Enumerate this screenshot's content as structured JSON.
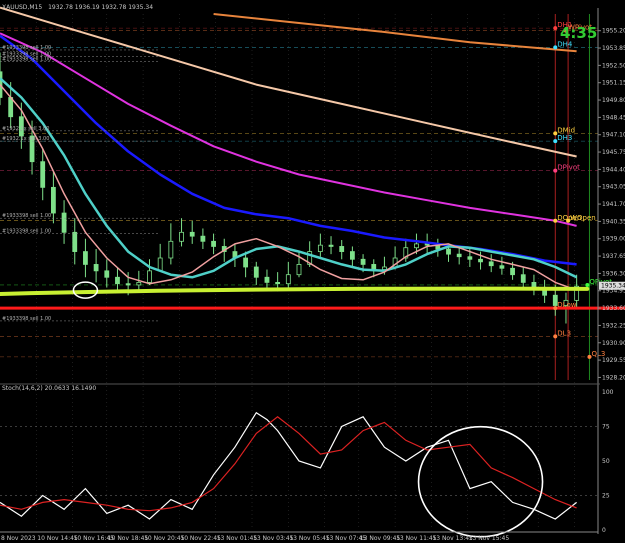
{
  "window": {
    "title": "XAUUSD,M15",
    "ohlc": "1932.78 1936.19 1932.78 1935.34",
    "timer": "4:35",
    "stoch_title": "Stoch(14,6,2) 20.0633 16.1490"
  },
  "colors": {
    "background": "#000000",
    "candle": "#7fe08a",
    "ma_blue": "#1a1aff",
    "ma_teal": "#4fd0c8",
    "ma_pink": "#f0a0a0",
    "ma_magenta": "#e033e0",
    "ma_peach": "#f5c8a8",
    "ma_orange": "#e8843c",
    "support": "#c8f032",
    "red_line": "#ff1a1a",
    "stoch_main": "#ffffff",
    "stoch_signal": "#dd2222",
    "timer": "#33cc33",
    "grid": "#3a3a3a"
  },
  "chart_data": [
    {
      "type": "line",
      "panel": "price",
      "ylim": [
        1928.0,
        1956.5
      ],
      "y_ticks": [
        1955.2,
        1953.85,
        1952.5,
        1951.15,
        1949.8,
        1948.45,
        1947.1,
        1945.75,
        1944.4,
        1943.05,
        1941.7,
        1940.35,
        1939.0,
        1937.65,
        1936.3,
        1934.95,
        1933.6,
        1932.25,
        1930.9,
        1929.55,
        1928.2
      ],
      "y_tick_labels": [
        "1955.20",
        "1953.85",
        "1952.50",
        "1951.15",
        "1949.80",
        "1948.45",
        "1947.10",
        "1945.75",
        "1944.40",
        "1943.05",
        "1941.70",
        "1940.35",
        "1939.00",
        "1937.65",
        "1936.30",
        "1934.95",
        "1933.60",
        "1932.25",
        "1930.90",
        "1929.55",
        "1928.20"
      ],
      "x_ticks": [
        0,
        17,
        34,
        50,
        67,
        84,
        101,
        118,
        135,
        152,
        168,
        185,
        202,
        219,
        236,
        252,
        269
      ],
      "x_tick_labels": [
        "8 Nov 2023",
        "10 Nov 14:45",
        "10 Nov 16:45",
        "10 Nov 18:45",
        "10 Nov 20:45",
        "10 Nov 22:45",
        "13 Nov 01:45",
        "13 Nov 03:45",
        "13 Nov 05:45",
        "13 Nov 07:45",
        "13 Nov 09:45",
        "13 Nov 11:45",
        "13 Nov 13:45",
        "13 Nov 15:45",
        "",
        "",
        ""
      ],
      "current_price": 1935.34,
      "current_price_label": "1935.34",
      "series": [
        {
          "key": "ma_orange",
          "x": [
            100,
            140,
            180,
            220,
            270
          ],
          "y": [
            1956.5,
            1955.8,
            1955.1,
            1954.3,
            1953.6
          ]
        },
        {
          "key": "ma_peach",
          "x": [
            0,
            40,
            80,
            120,
            160,
            200,
            240,
            270
          ],
          "y": [
            1957.0,
            1955.0,
            1953.0,
            1951.0,
            1949.5,
            1948.0,
            1946.5,
            1945.4
          ]
        },
        {
          "key": "ma_magenta",
          "x": [
            0,
            20,
            40,
            60,
            80,
            100,
            120,
            140,
            160,
            180,
            200,
            220,
            240,
            260,
            270
          ],
          "y": [
            1955.0,
            1953.5,
            1951.5,
            1949.5,
            1947.8,
            1946.2,
            1945.0,
            1944.0,
            1943.3,
            1942.6,
            1942.0,
            1941.4,
            1940.9,
            1940.4,
            1940.0
          ]
        },
        {
          "key": "ma_blue",
          "x": [
            0,
            15,
            30,
            45,
            60,
            75,
            90,
            105,
            120,
            135,
            150,
            165,
            180,
            195,
            210,
            225,
            240,
            255,
            270
          ],
          "y": [
            1954.8,
            1953.0,
            1950.5,
            1948.0,
            1945.8,
            1944.0,
            1942.5,
            1941.4,
            1940.9,
            1940.6,
            1940.0,
            1939.6,
            1939.1,
            1938.8,
            1938.5,
            1938.2,
            1937.8,
            1937.3,
            1937.0
          ]
        },
        {
          "key": "ma_teal",
          "x": [
            0,
            10,
            20,
            30,
            40,
            50,
            60,
            70,
            80,
            90,
            100,
            110,
            120,
            130,
            140,
            150,
            160,
            170,
            180,
            190,
            200,
            210,
            220,
            230,
            240,
            250,
            260,
            270
          ],
          "y": [
            1951.5,
            1950.0,
            1948.0,
            1945.5,
            1942.5,
            1940.0,
            1938.0,
            1936.8,
            1936.2,
            1936.0,
            1936.5,
            1937.5,
            1938.2,
            1938.4,
            1938.0,
            1937.5,
            1937.0,
            1936.6,
            1936.5,
            1937.0,
            1937.8,
            1938.4,
            1938.3,
            1938.0,
            1937.7,
            1937.4,
            1936.8,
            1936.0
          ]
        },
        {
          "key": "ma_pink",
          "x": [
            0,
            10,
            20,
            30,
            40,
            50,
            60,
            70,
            80,
            90,
            100,
            110,
            120,
            130,
            140,
            150,
            160,
            170,
            180,
            190,
            200,
            210,
            220,
            230,
            240,
            250,
            260,
            270
          ],
          "y": [
            1951.0,
            1949.0,
            1946.0,
            1942.5,
            1939.5,
            1937.5,
            1936.0,
            1935.5,
            1935.8,
            1936.4,
            1937.6,
            1938.6,
            1939.0,
            1938.4,
            1937.6,
            1936.6,
            1935.9,
            1935.8,
            1936.4,
            1937.6,
            1938.4,
            1938.6,
            1938.0,
            1937.4,
            1937.0,
            1936.6,
            1935.6,
            1935.0
          ]
        }
      ],
      "candles": {
        "x": [
          0,
          5,
          10,
          15,
          20,
          25,
          30,
          35,
          40,
          45,
          50,
          55,
          60,
          65,
          70,
          75,
          80,
          85,
          90,
          95,
          100,
          105,
          110,
          115,
          120,
          125,
          130,
          135,
          140,
          145,
          150,
          155,
          160,
          165,
          170,
          175,
          180,
          185,
          190,
          195,
          200,
          205,
          210,
          215,
          220,
          225,
          230,
          235,
          240,
          245,
          250,
          255,
          260,
          265,
          270
        ],
        "o": [
          1952.0,
          1950.0,
          1948.5,
          1947.0,
          1945.0,
          1943.0,
          1941.0,
          1939.5,
          1938.0,
          1937.0,
          1936.5,
          1936.0,
          1935.5,
          1935.4,
          1935.6,
          1936.5,
          1937.5,
          1938.8,
          1939.5,
          1939.2,
          1938.8,
          1938.4,
          1938.0,
          1937.5,
          1936.8,
          1936.0,
          1935.6,
          1935.5,
          1936.2,
          1937.0,
          1938.0,
          1938.5,
          1938.4,
          1938.0,
          1937.4,
          1937.0,
          1936.6,
          1936.8,
          1937.5,
          1938.3,
          1938.6,
          1938.5,
          1938.2,
          1937.8,
          1937.6,
          1937.4,
          1937.2,
          1936.9,
          1936.7,
          1936.2,
          1935.6,
          1935.2,
          1934.6,
          1933.8,
          1934.2
        ],
        "c": [
          1950.0,
          1948.5,
          1947.0,
          1945.0,
          1943.0,
          1941.0,
          1939.5,
          1938.0,
          1937.0,
          1936.5,
          1936.0,
          1935.5,
          1935.4,
          1935.6,
          1936.5,
          1937.5,
          1938.8,
          1939.5,
          1939.2,
          1938.8,
          1938.4,
          1938.0,
          1937.5,
          1936.8,
          1936.0,
          1935.6,
          1935.5,
          1936.2,
          1937.0,
          1938.0,
          1938.5,
          1938.4,
          1938.0,
          1937.4,
          1937.0,
          1936.6,
          1936.8,
          1937.5,
          1938.3,
          1938.6,
          1938.5,
          1938.2,
          1937.8,
          1937.6,
          1937.4,
          1937.2,
          1936.9,
          1936.7,
          1936.2,
          1935.6,
          1935.2,
          1934.6,
          1933.8,
          1934.2,
          1935.3
        ],
        "h": [
          1953.5,
          1951.2,
          1949.6,
          1948.2,
          1946.0,
          1944.2,
          1942.0,
          1940.6,
          1939.0,
          1938.2,
          1937.4,
          1936.8,
          1936.4,
          1936.5,
          1937.4,
          1938.6,
          1940.2,
          1940.6,
          1940.4,
          1939.8,
          1939.4,
          1939.0,
          1938.6,
          1938.0,
          1937.2,
          1936.6,
          1936.4,
          1937.2,
          1938.0,
          1938.8,
          1939.4,
          1939.2,
          1938.9,
          1938.4,
          1937.8,
          1937.4,
          1937.6,
          1938.4,
          1939.0,
          1939.4,
          1939.4,
          1939.0,
          1938.6,
          1938.4,
          1938.2,
          1938.0,
          1937.8,
          1937.6,
          1937.2,
          1936.8,
          1936.2,
          1935.8,
          1935.4,
          1934.8,
          1936.2
        ],
        "l": [
          1949.4,
          1947.6,
          1946.0,
          1944.0,
          1942.0,
          1940.2,
          1938.6,
          1937.0,
          1936.0,
          1935.6,
          1935.2,
          1934.8,
          1934.6,
          1934.8,
          1935.4,
          1936.6,
          1937.0,
          1938.4,
          1938.6,
          1938.2,
          1937.8,
          1937.2,
          1936.8,
          1936.0,
          1935.4,
          1935.0,
          1934.9,
          1935.2,
          1936.0,
          1936.8,
          1937.6,
          1937.8,
          1937.4,
          1936.8,
          1936.4,
          1936.0,
          1936.2,
          1936.6,
          1937.2,
          1937.8,
          1937.8,
          1937.6,
          1937.2,
          1937.0,
          1936.8,
          1936.6,
          1936.4,
          1936.2,
          1935.8,
          1935.0,
          1934.6,
          1934.0,
          1933.0,
          1932.4,
          1933.6
        ]
      },
      "support_level": 1934.8,
      "red_level": 1933.6,
      "levels": [
        {
          "label": "DH1",
          "y": 1955.4,
          "x": 260,
          "color": "#ff4040"
        },
        {
          "label": "WPivot",
          "y": 1955.2,
          "x": 265,
          "color": "#ff8040"
        },
        {
          "label": "DH4",
          "y": 1953.9,
          "x": 260,
          "color": "#40e0ff"
        },
        {
          "label": "DMid",
          "y": 1947.2,
          "x": 260,
          "color": "#ffd040"
        },
        {
          "label": "DH3",
          "y": 1946.6,
          "x": 260,
          "color": "#40e0ff"
        },
        {
          "label": "DPivot",
          "y": 1944.3,
          "x": 260,
          "color": "#ff4080"
        },
        {
          "label": "DOpen",
          "y": 1940.4,
          "x": 260,
          "color": "#ffd040"
        },
        {
          "label": "WOpen",
          "y": 1940.4,
          "x": 266,
          "color": "#ffd040"
        },
        {
          "label": "QPivot",
          "y": 1935.4,
          "x": 275,
          "color": "#40ff40"
        },
        {
          "label": "DLow",
          "y": 1933.6,
          "x": 260,
          "color": "#ff8040"
        },
        {
          "label": "DL3",
          "y": 1931.4,
          "x": 260,
          "color": "#ff8040"
        },
        {
          "label": "QL3",
          "y": 1929.8,
          "x": 276,
          "color": "#ff8040"
        }
      ],
      "left_tags": [
        "#1933398 sell 1.00",
        "#1933398 sell 1.00",
        "#1933398 sell 1.00",
        "#1932.1x sell 3.00",
        "#1932.1x sell 3.00",
        "#1933398 sell 1.00",
        "#1933398 sell 1.00",
        "#1933398 sell 1.00"
      ]
    },
    {
      "type": "line",
      "panel": "stochastic",
      "ylim": [
        0,
        100
      ],
      "y_ticks": [
        100,
        75,
        50,
        25,
        0
      ],
      "y_tick_labels": [
        "100",
        "75",
        "50",
        "25",
        "0"
      ],
      "levels": [
        75,
        25
      ],
      "series": [
        {
          "key": "stoch_main",
          "x": [
            0,
            10,
            20,
            30,
            40,
            50,
            60,
            70,
            80,
            90,
            100,
            110,
            120,
            125,
            130,
            140,
            150,
            160,
            170,
            180,
            190,
            200,
            210,
            220,
            230,
            240,
            250,
            260,
            270
          ],
          "y": [
            20,
            10,
            25,
            15,
            30,
            12,
            18,
            8,
            22,
            15,
            40,
            60,
            85,
            80,
            72,
            50,
            45,
            75,
            82,
            60,
            50,
            60,
            65,
            30,
            35,
            20,
            15,
            8,
            20
          ]
        },
        {
          "key": "stoch_signal",
          "x": [
            0,
            10,
            20,
            30,
            40,
            50,
            60,
            70,
            80,
            90,
            100,
            110,
            120,
            130,
            140,
            150,
            160,
            170,
            180,
            190,
            200,
            210,
            220,
            230,
            240,
            250,
            260,
            270
          ],
          "y": [
            18,
            15,
            20,
            22,
            20,
            18,
            15,
            14,
            16,
            20,
            30,
            48,
            70,
            82,
            70,
            55,
            58,
            72,
            78,
            65,
            58,
            60,
            62,
            45,
            38,
            30,
            22,
            16
          ]
        }
      ]
    }
  ]
}
